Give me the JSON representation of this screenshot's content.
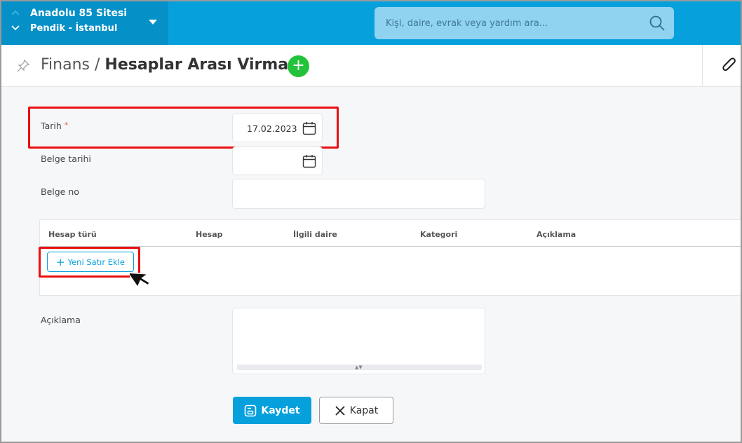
{
  "site": {
    "name": "Anadolu 85 Sitesi",
    "city": "Pendik - İstanbul"
  },
  "search": {
    "placeholder": "Kişi, daire, evrak veya yardım ara..."
  },
  "title": {
    "section": "Finans",
    "separator": " / ",
    "page": "Hesaplar Arası Virman",
    "add_symbol": "+"
  },
  "form": {
    "date_label": "Tarih",
    "required_mark": "*",
    "date_value": "17.02.2023",
    "doc_date_label": "Belge tarihi",
    "doc_date_value": "",
    "doc_no_label": "Belge no",
    "doc_no_value": "",
    "desc_label": "Açıklama",
    "desc_value": ""
  },
  "grid": {
    "columns": [
      "Hesap türü",
      "Hesap",
      "İlgili daire",
      "Kategori",
      "Açıklama"
    ],
    "add_row_label": "Yeni Satır Ekle"
  },
  "actions": {
    "save_label": "Kaydet",
    "close_label": "Kapat"
  },
  "colors": {
    "accent": "#06a0dd",
    "success": "#22c33a",
    "highlight": "#ea0f0f"
  }
}
